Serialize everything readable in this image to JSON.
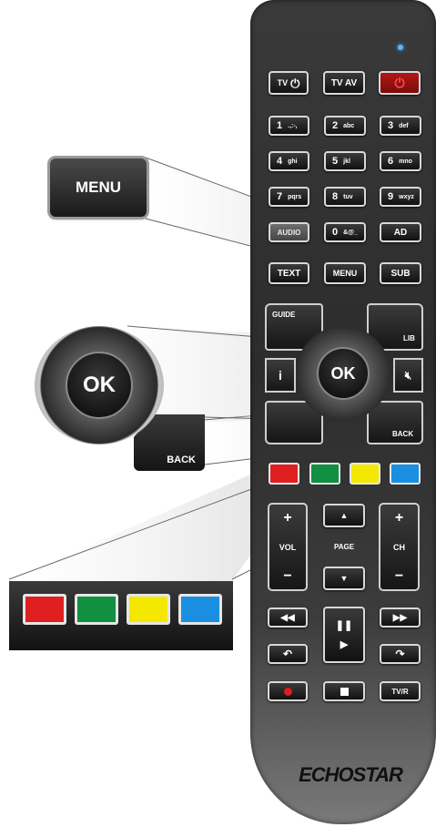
{
  "remote": {
    "top_row": {
      "tv_power": "TV",
      "tv_av": "TV AV"
    },
    "numbers": [
      {
        "n": "1",
        "letters": ".,:-,"
      },
      {
        "n": "2",
        "letters": "abc"
      },
      {
        "n": "3",
        "letters": "def"
      },
      {
        "n": "4",
        "letters": "ghi"
      },
      {
        "n": "5",
        "letters": "jkl"
      },
      {
        "n": "6",
        "letters": "mno"
      },
      {
        "n": "7",
        "letters": "pqrs"
      },
      {
        "n": "8",
        "letters": "tuv"
      },
      {
        "n": "9",
        "letters": "wxyz"
      },
      {
        "n": "0",
        "letters": "&@_"
      }
    ],
    "audio": "AUDIO",
    "ad": "AD",
    "text": "TEXT",
    "menu": "MENU",
    "sub": "SUB",
    "guide": "GUIDE",
    "lib": "LIB",
    "info": "i",
    "ok": "OK",
    "back": "BACK",
    "vol_plus": "+",
    "vol_label": "VOL",
    "vol_minus": "−",
    "page_label": "PAGE",
    "ch_plus": "+",
    "ch_label": "CH",
    "ch_minus": "−",
    "tvr": "TV/R",
    "brand": "ECHOSTAR"
  },
  "callouts": {
    "menu": "MENU",
    "ok": "OK",
    "back": "BACK"
  },
  "colors": {
    "red": "#e02020",
    "green": "#109040",
    "yellow": "#f5e800",
    "blue": "#1a8fe0",
    "power_red": "#cc1a1a",
    "led_blue": "#5ab4ff"
  }
}
